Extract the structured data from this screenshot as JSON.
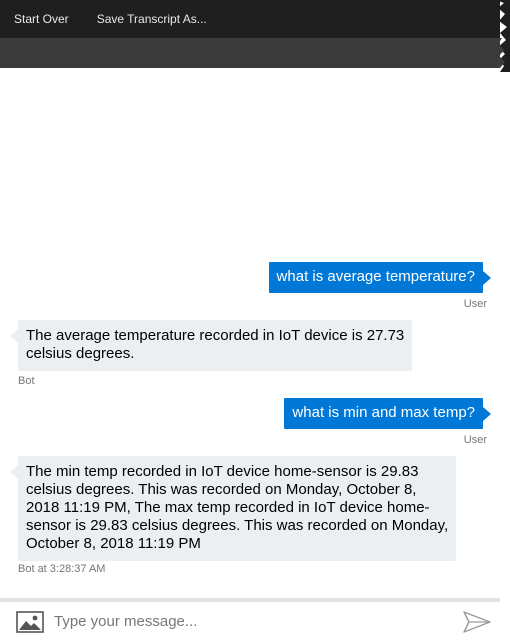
{
  "menu": {
    "items": [
      {
        "label": "Start Over"
      },
      {
        "label": "Save Transcript As..."
      }
    ]
  },
  "messages": [
    {
      "from": "user",
      "text": "what is average temperature?",
      "meta": "User"
    },
    {
      "from": "bot",
      "lines": [
        "The average temperature recorded in IoT device is 27.73",
        "celsius degrees."
      ],
      "meta": "Bot"
    },
    {
      "from": "user",
      "text": "what is min and max temp?",
      "meta": "User"
    },
    {
      "from": "bot",
      "lines": [
        "The min temp recorded in IoT device home-sensor is 29.83",
        "celsius degrees. This was recorded on Monday, October 8,",
        "2018 11:19 PM, The max temp recorded in IoT device home-",
        "sensor is 29.83 celsius degrees. This was recorded on Monday,",
        "October 8, 2018 11:19 PM"
      ],
      "meta": "Bot at 3:28:37 AM"
    }
  ],
  "input": {
    "placeholder": "Type your message...",
    "value": ""
  },
  "icons": {
    "upload": "image-icon",
    "send": "send-icon"
  },
  "colors": {
    "menubar": "#1f1f1f",
    "toolbar": "#3b3b3b",
    "user_bubble": "#0078d7",
    "bot_bubble": "#eceff1",
    "meta_text": "#767676"
  }
}
